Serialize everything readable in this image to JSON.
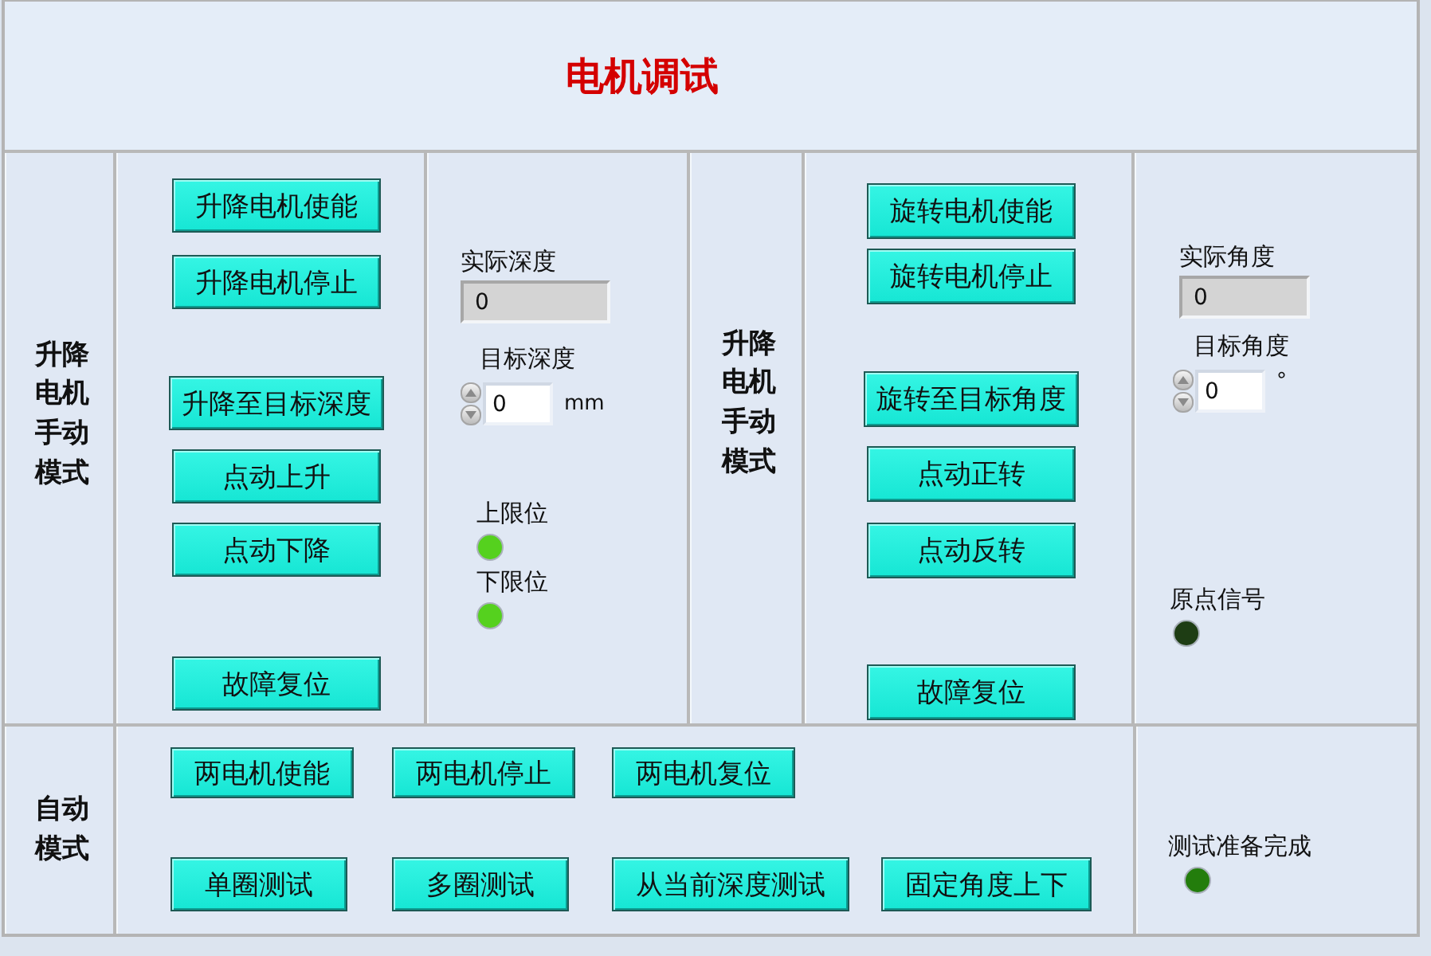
{
  "title": "电机调试",
  "lift_section": {
    "label": "升降电机手动模式",
    "buttons": [
      "升降电机使能",
      "升降电机停止",
      "升降至目标深度",
      "点动上升",
      "点动下降",
      "故障复位"
    ],
    "actual_depth": {
      "label": "实际深度",
      "value": "0"
    },
    "target_depth": {
      "label": "目标深度",
      "value": "0",
      "unit": "mm"
    },
    "indicators": [
      {
        "label": "上限位",
        "color": "#55d11e"
      },
      {
        "label": "下限位",
        "color": "#55d11e"
      }
    ]
  },
  "rotate_section": {
    "label": "升降电机手动模式",
    "buttons": [
      "旋转电机使能",
      "旋转电机停止",
      "旋转至目标角度",
      "点动正转",
      "点动反转",
      "故障复位"
    ],
    "actual_angle": {
      "label": "实际角度",
      "value": "0"
    },
    "target_angle": {
      "label": "目标角度",
      "value": "0",
      "unit": "°"
    },
    "indicators": [
      {
        "label": "原点信号",
        "color": "#1e3d14"
      }
    ]
  },
  "auto_section": {
    "label": "自动模式",
    "button_rows": [
      {
        "buttons": [
          "两电机使能",
          "两电机停止",
          "两电机复位"
        ]
      },
      {
        "buttons": [
          "单圈测试",
          "多圈测试",
          "从当前深度测试",
          "固定角度上下"
        ]
      }
    ],
    "indicators": [
      {
        "label": "测试准备完成",
        "color": "#237d0c"
      }
    ]
  }
}
